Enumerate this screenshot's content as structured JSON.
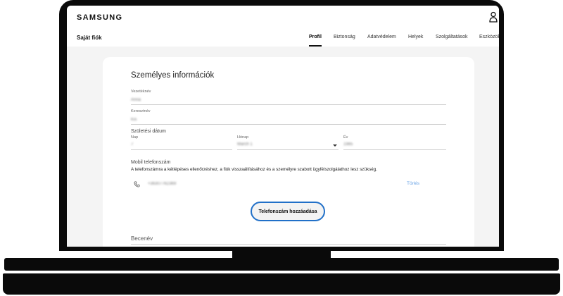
{
  "header": {
    "logo": "SAMSUNG",
    "account_title": "Saját fiók",
    "tabs": [
      {
        "label": "Profil",
        "active": true
      },
      {
        "label": "Biztonság",
        "active": false
      },
      {
        "label": "Adatvédelem",
        "active": false
      },
      {
        "label": "Helyek",
        "active": false
      },
      {
        "label": "Szolgáltatások",
        "active": false
      },
      {
        "label": "Eszközök",
        "active": false
      }
    ]
  },
  "personal_info": {
    "title": "Személyes információk",
    "last_name": {
      "label": "Vezetéknév",
      "value": "Anna"
    },
    "first_name": {
      "label": "Keresztnév",
      "value": "Kis"
    },
    "birth_date": {
      "label": "Születési dátum",
      "day": {
        "label": "Nap",
        "value": "7"
      },
      "month": {
        "label": "Hónap",
        "value": "March 1"
      },
      "year": {
        "label": "Év",
        "value": "1985"
      }
    },
    "mobile": {
      "label": "Mobil telefonszám",
      "helper": "A telefonszámra a kétlépéses ellenőrzéshez, a fiók visszaállításához és a személyre szabott ügyfélszolgálathoz lesz szükség.",
      "number": "+36307762369",
      "delete_label": "Törlés",
      "add_button_label": "Telefonszám hozzáadása"
    },
    "nickname": {
      "label": "Becenév",
      "value": ""
    }
  },
  "colors": {
    "accent_outline": "#2170c8",
    "link": "#6aa4e6",
    "screen_background": "#f4f4f4"
  },
  "icons": {
    "user": "person-outline-icon",
    "phone": "phone-icon",
    "dropdown": "caret-down-icon"
  }
}
